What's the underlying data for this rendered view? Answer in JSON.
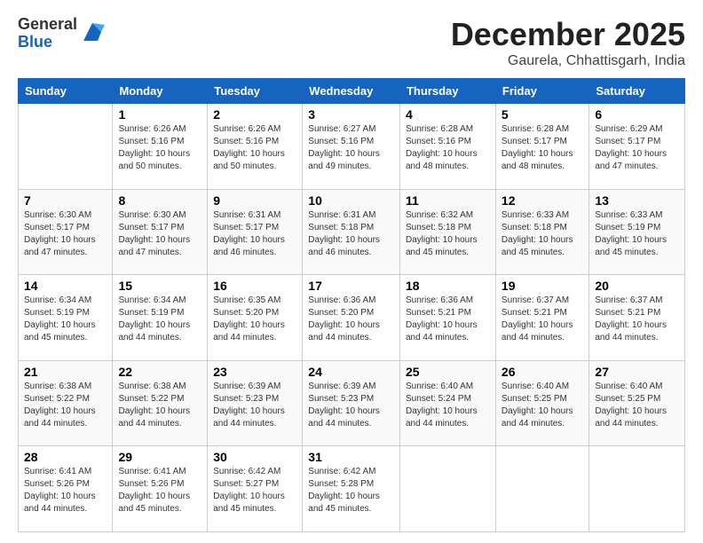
{
  "header": {
    "logo_line1": "General",
    "logo_line2": "Blue",
    "title": "December 2025",
    "subtitle": "Gaurela, Chhattisgarh, India"
  },
  "weekdays": [
    "Sunday",
    "Monday",
    "Tuesday",
    "Wednesday",
    "Thursday",
    "Friday",
    "Saturday"
  ],
  "weeks": [
    [
      {
        "day": "",
        "info": ""
      },
      {
        "day": "1",
        "info": "Sunrise: 6:26 AM\nSunset: 5:16 PM\nDaylight: 10 hours\nand 50 minutes."
      },
      {
        "day": "2",
        "info": "Sunrise: 6:26 AM\nSunset: 5:16 PM\nDaylight: 10 hours\nand 50 minutes."
      },
      {
        "day": "3",
        "info": "Sunrise: 6:27 AM\nSunset: 5:16 PM\nDaylight: 10 hours\nand 49 minutes."
      },
      {
        "day": "4",
        "info": "Sunrise: 6:28 AM\nSunset: 5:16 PM\nDaylight: 10 hours\nand 48 minutes."
      },
      {
        "day": "5",
        "info": "Sunrise: 6:28 AM\nSunset: 5:17 PM\nDaylight: 10 hours\nand 48 minutes."
      },
      {
        "day": "6",
        "info": "Sunrise: 6:29 AM\nSunset: 5:17 PM\nDaylight: 10 hours\nand 47 minutes."
      }
    ],
    [
      {
        "day": "7",
        "info": "Sunrise: 6:30 AM\nSunset: 5:17 PM\nDaylight: 10 hours\nand 47 minutes."
      },
      {
        "day": "8",
        "info": "Sunrise: 6:30 AM\nSunset: 5:17 PM\nDaylight: 10 hours\nand 47 minutes."
      },
      {
        "day": "9",
        "info": "Sunrise: 6:31 AM\nSunset: 5:17 PM\nDaylight: 10 hours\nand 46 minutes."
      },
      {
        "day": "10",
        "info": "Sunrise: 6:31 AM\nSunset: 5:18 PM\nDaylight: 10 hours\nand 46 minutes."
      },
      {
        "day": "11",
        "info": "Sunrise: 6:32 AM\nSunset: 5:18 PM\nDaylight: 10 hours\nand 45 minutes."
      },
      {
        "day": "12",
        "info": "Sunrise: 6:33 AM\nSunset: 5:18 PM\nDaylight: 10 hours\nand 45 minutes."
      },
      {
        "day": "13",
        "info": "Sunrise: 6:33 AM\nSunset: 5:19 PM\nDaylight: 10 hours\nand 45 minutes."
      }
    ],
    [
      {
        "day": "14",
        "info": "Sunrise: 6:34 AM\nSunset: 5:19 PM\nDaylight: 10 hours\nand 45 minutes."
      },
      {
        "day": "15",
        "info": "Sunrise: 6:34 AM\nSunset: 5:19 PM\nDaylight: 10 hours\nand 44 minutes."
      },
      {
        "day": "16",
        "info": "Sunrise: 6:35 AM\nSunset: 5:20 PM\nDaylight: 10 hours\nand 44 minutes."
      },
      {
        "day": "17",
        "info": "Sunrise: 6:36 AM\nSunset: 5:20 PM\nDaylight: 10 hours\nand 44 minutes."
      },
      {
        "day": "18",
        "info": "Sunrise: 6:36 AM\nSunset: 5:21 PM\nDaylight: 10 hours\nand 44 minutes."
      },
      {
        "day": "19",
        "info": "Sunrise: 6:37 AM\nSunset: 5:21 PM\nDaylight: 10 hours\nand 44 minutes."
      },
      {
        "day": "20",
        "info": "Sunrise: 6:37 AM\nSunset: 5:21 PM\nDaylight: 10 hours\nand 44 minutes."
      }
    ],
    [
      {
        "day": "21",
        "info": "Sunrise: 6:38 AM\nSunset: 5:22 PM\nDaylight: 10 hours\nand 44 minutes."
      },
      {
        "day": "22",
        "info": "Sunrise: 6:38 AM\nSunset: 5:22 PM\nDaylight: 10 hours\nand 44 minutes."
      },
      {
        "day": "23",
        "info": "Sunrise: 6:39 AM\nSunset: 5:23 PM\nDaylight: 10 hours\nand 44 minutes."
      },
      {
        "day": "24",
        "info": "Sunrise: 6:39 AM\nSunset: 5:23 PM\nDaylight: 10 hours\nand 44 minutes."
      },
      {
        "day": "25",
        "info": "Sunrise: 6:40 AM\nSunset: 5:24 PM\nDaylight: 10 hours\nand 44 minutes."
      },
      {
        "day": "26",
        "info": "Sunrise: 6:40 AM\nSunset: 5:25 PM\nDaylight: 10 hours\nand 44 minutes."
      },
      {
        "day": "27",
        "info": "Sunrise: 6:40 AM\nSunset: 5:25 PM\nDaylight: 10 hours\nand 44 minutes."
      }
    ],
    [
      {
        "day": "28",
        "info": "Sunrise: 6:41 AM\nSunset: 5:26 PM\nDaylight: 10 hours\nand 44 minutes."
      },
      {
        "day": "29",
        "info": "Sunrise: 6:41 AM\nSunset: 5:26 PM\nDaylight: 10 hours\nand 45 minutes."
      },
      {
        "day": "30",
        "info": "Sunrise: 6:42 AM\nSunset: 5:27 PM\nDaylight: 10 hours\nand 45 minutes."
      },
      {
        "day": "31",
        "info": "Sunrise: 6:42 AM\nSunset: 5:28 PM\nDaylight: 10 hours\nand 45 minutes."
      },
      {
        "day": "",
        "info": ""
      },
      {
        "day": "",
        "info": ""
      },
      {
        "day": "",
        "info": ""
      }
    ]
  ]
}
